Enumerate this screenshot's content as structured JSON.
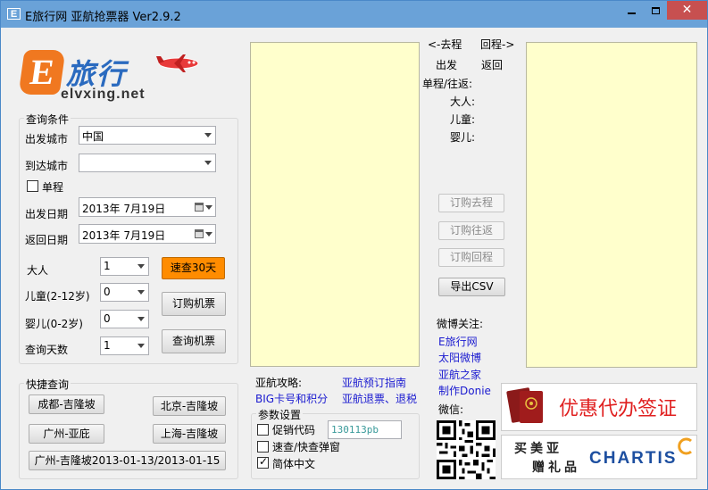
{
  "window": {
    "icon_text": "E",
    "title": "E旅行网 亚航抢票器 Ver2.9.2",
    "minimize_label": "",
    "maximize_label": "",
    "close_label": "✕"
  },
  "logo": {
    "letter": "E",
    "brand_cn": "旅行",
    "url": "elvxing.net"
  },
  "query": {
    "group_title": "查询条件",
    "from_label": "出发城市",
    "from_value": "中国",
    "to_label": "到达城市",
    "to_value": "",
    "oneway_label": "单程",
    "oneway_checked": false,
    "depart_label": "出发日期",
    "depart_value": "2013年  7月19日",
    "return_label": "返回日期",
    "return_value": "2013年  7月19日",
    "adult_label": "大人",
    "adult_value": "1",
    "child_label": "儿童(2-12岁)",
    "child_value": "0",
    "infant_label": "婴儿(0-2岁)",
    "infant_value": "0",
    "days_label": "查询天数",
    "days_value": "1",
    "quick30_label": "速查30天",
    "book_label": "订购机票",
    "search_label": "查询机票"
  },
  "quick": {
    "group_title": "快捷查询",
    "btn1": "成都-吉隆坡",
    "btn2": "北京-吉隆坡",
    "btn3": "广州-亚庇",
    "btn4": "上海-吉隆坡",
    "btn5": "广州-吉隆坡2013-01-13/2013-01-15"
  },
  "center": {
    "outbound_arrow": "<-去程",
    "return_arrow": "回程->",
    "depart": "出发",
    "back": "返回",
    "trip_type": "单程/往返:",
    "adult": "大人:",
    "child": "儿童:",
    "infant": "婴儿:",
    "book_out": "订购去程",
    "book_round": "订购往返",
    "book_back": "订购回程",
    "export_csv": "导出CSV"
  },
  "guide": {
    "label": "亚航攻略:",
    "link1": "亚航预订指南",
    "link2": "BIG卡号和积分",
    "link3": "亚航退票、退税"
  },
  "params": {
    "group_title": "参数设置",
    "promo_label": "促销代码",
    "promo_checked": false,
    "promo_value": "130113pb",
    "popup_label": "速查/快查弹窗",
    "popup_checked": false,
    "simplified_label": "简体中文",
    "simplified_checked": true
  },
  "weibo": {
    "title": "微博关注:",
    "link1": "E旅行网",
    "link2": "太阳微博",
    "link3": "亚航之家",
    "link4": "制作Donie",
    "wechat": "微信:"
  },
  "ads": {
    "visa": "优惠代办签证",
    "gift_line1": "买美亚",
    "gift_line2": "赠礼品",
    "chartis": "CHARTIS"
  },
  "colors": {
    "titlebar": "#6aa2d8",
    "result_panel": "#ffffcc",
    "orange_button": "#ff8c00",
    "link": "#1a1ad0",
    "visa_red": "#e02020",
    "chartis_blue": "#1d4fa0"
  }
}
